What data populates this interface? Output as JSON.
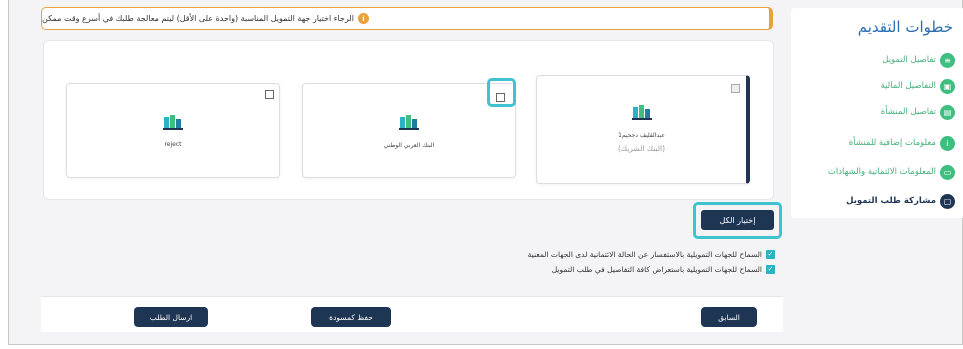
{
  "alert": {
    "text": "الرجاء اختيار جهة التمويل المناسبة (واحدة على الأقل) ليتم معالجة طلبك في أسرع وقت ممكن",
    "icon": "info-icon"
  },
  "sidebar": {
    "title": "خطوات التقديم",
    "steps": [
      {
        "label": "تفاصيل التمويل",
        "icon": "list-icon"
      },
      {
        "label": "التفاصيل المالية",
        "icon": "money-icon"
      },
      {
        "label": "تفاصيل المنشأة",
        "icon": "building-icon"
      },
      {
        "label": "معلومات إضافية للمنشأة",
        "icon": "info-icon"
      },
      {
        "label": "المعلومات الائتمانية والشهادات",
        "icon": "certificate-icon"
      },
      {
        "label": "مشاركة طلب التمويل",
        "icon": "share-icon"
      }
    ]
  },
  "cards": [
    {
      "name": "عبدالقليف دجحيم1",
      "sub": "(البنك الشريك)"
    },
    {
      "name": "البنك العربي الوطني",
      "sub": ""
    },
    {
      "name": "reject",
      "sub": ""
    }
  ],
  "select_all_label": "إختيار الكل",
  "consents": [
    "السماح للجهات التمويلية بالاستفسار عن الحالة الائتمانية لدى الجهات المعنية",
    "السماح للجهات التمويلية باستعراض كافة التفاصيل في طلب التمويل"
  ],
  "footer": {
    "previous_label": "السابق",
    "save_draft_label": "حفظ كمسودة",
    "submit_label": "ارسال الطلب"
  },
  "colors": {
    "primary": "#1f3554",
    "accent": "#3fbf7f",
    "warning": "#e8a23c",
    "highlight": "#3fc3d1"
  }
}
